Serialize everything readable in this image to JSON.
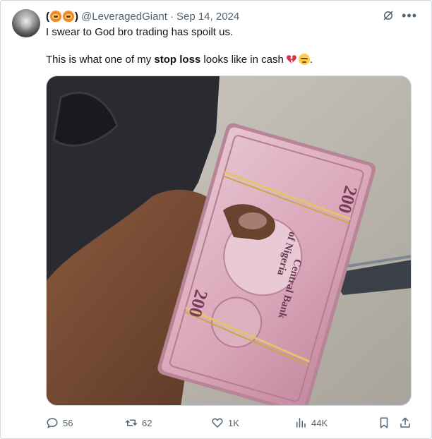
{
  "tweet": {
    "display_name_open": "(",
    "display_name_close": ")",
    "handle": "@LeveragedGiant",
    "separator": "·",
    "date": "Sep 14, 2024",
    "text_line1": "I swear to God bro trading has spoilt us.",
    "text_line2_pre": "This is what one of my ",
    "text_line2_bold": "stop loss",
    "text_line2_post": " looks like in cash",
    "text_line2_end": "."
  },
  "media": {
    "banknote_text_value": "200",
    "banknote_text_bank": "Central Bank",
    "banknote_text_country": "of Nigeria"
  },
  "actions": {
    "replies": "56",
    "retweets": "62",
    "likes": "1K",
    "views": "44K"
  },
  "icons": [
    "grok-icon",
    "more-icon",
    "reply-icon",
    "retweet-icon",
    "like-icon",
    "views-icon",
    "bookmark-icon",
    "share-icon"
  ],
  "colors": {
    "text": "#0f1419",
    "muted": "#536471",
    "border": "#cfd9de",
    "note_pink": "#d9a6b8"
  }
}
